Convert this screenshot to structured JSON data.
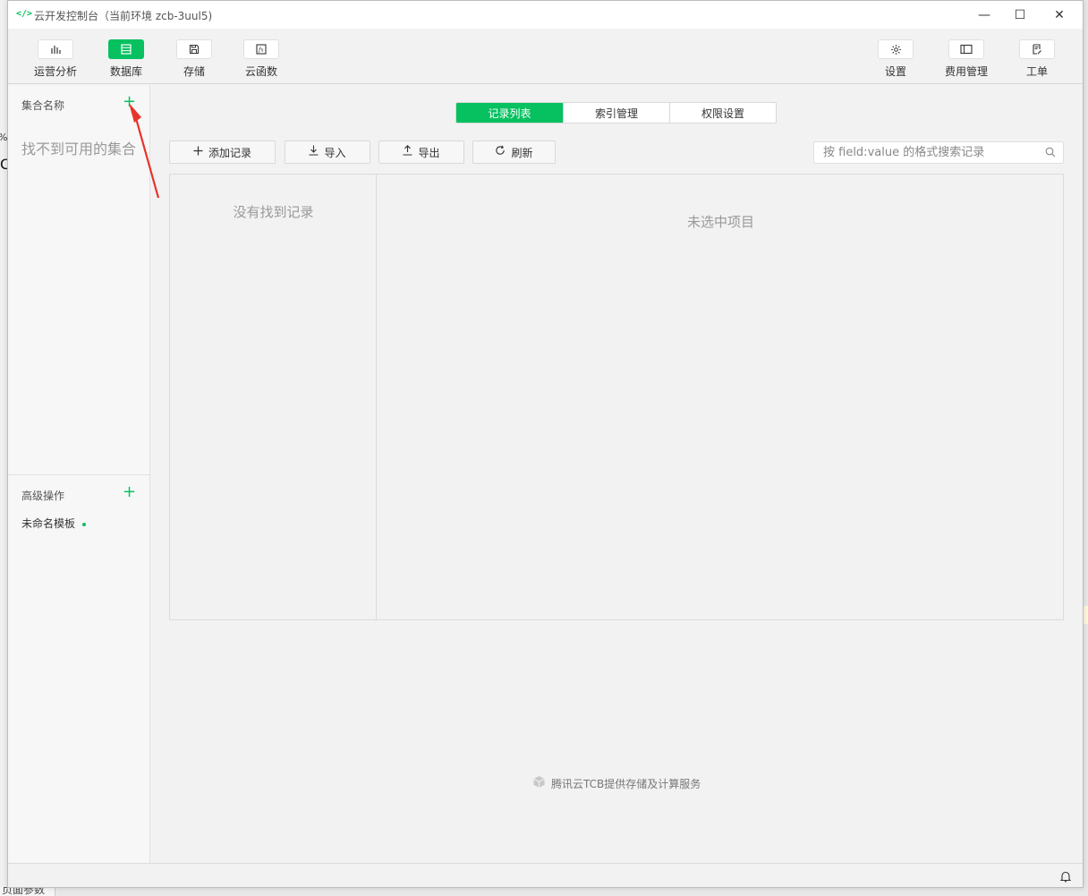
{
  "window": {
    "title": "云开发控制台（当前环境 zcb-3uul5)",
    "app_icon": "</>",
    "controls": {
      "minimize": "—",
      "maximize": "☐",
      "close": "✕"
    }
  },
  "toolbar": {
    "left": [
      {
        "label": "运营分析",
        "icon": "bar-chart-icon",
        "active": false
      },
      {
        "label": "数据库",
        "icon": "database-icon",
        "active": true
      },
      {
        "label": "存储",
        "icon": "storage-icon",
        "active": false
      },
      {
        "label": "云函数",
        "icon": "function-icon",
        "active": false
      }
    ],
    "right": [
      {
        "label": "设置",
        "icon": "gear-icon"
      },
      {
        "label": "费用管理",
        "icon": "billing-icon"
      },
      {
        "label": "工单",
        "icon": "ticket-icon"
      }
    ]
  },
  "sidebar": {
    "collections_header": "集合名称",
    "add_symbol": "+",
    "empty_text": "找不到可用的集合",
    "advanced_header": "高级操作",
    "template_item": "未命名模板"
  },
  "main": {
    "tabs": [
      {
        "label": "记录列表",
        "active": true
      },
      {
        "label": "索引管理",
        "active": false
      },
      {
        "label": "权限设置",
        "active": false
      }
    ],
    "actions": {
      "add": "添加记录",
      "import": "导入",
      "export": "导出",
      "refresh": "刷新"
    },
    "search_placeholder": "按 field:value 的格式搜索记录",
    "list_empty": "没有找到记录",
    "detail_empty": "未选中项目",
    "footer_credit": "腾讯云TCB提供存储及计算服务"
  },
  "background": {
    "left_pct": "%",
    "left_char": "C",
    "bottom_tab": "页面参数"
  },
  "colors": {
    "accent": "#07c160",
    "annotation_arrow": "#e8332a"
  }
}
